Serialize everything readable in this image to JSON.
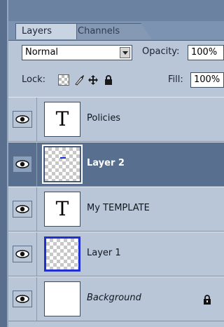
{
  "tabs": {
    "layers_label": "Layers",
    "channels_label": "Channels"
  },
  "blend_mode": {
    "value": "Normal"
  },
  "opacity": {
    "label": "Opacity:",
    "value": "100%"
  },
  "lock": {
    "label": "Lock:"
  },
  "fill": {
    "label": "Fill:",
    "value": "100%"
  },
  "layers": [
    {
      "name": "Policies",
      "type": "text",
      "thumb_glyph": "T"
    },
    {
      "name": "Layer 2",
      "type": "pixel",
      "selected": true
    },
    {
      "name": "My TEMPLATE",
      "type": "text",
      "thumb_glyph": "T"
    },
    {
      "name": "Layer 1",
      "type": "pixel"
    },
    {
      "name": "Background",
      "type": "background",
      "locked": true
    }
  ],
  "colors": {
    "panel": "#b9c6d8",
    "selected_row": "#586f8f",
    "frame": "#7d93b2"
  },
  "icons": [
    "eye-icon",
    "lock-transparent-icon",
    "lock-brush-icon",
    "lock-move-icon",
    "lock-all-icon",
    "lock-icon",
    "dropdown-arrow-icon"
  ]
}
